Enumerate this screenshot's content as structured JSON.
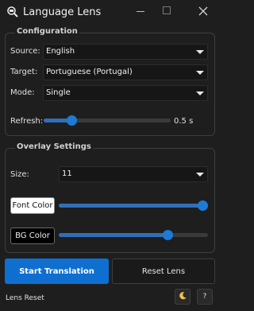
{
  "window": {
    "title": "Language Lens",
    "icon": "magnifier-icon"
  },
  "configuration": {
    "title": "Configuration",
    "source": {
      "label": "Source:",
      "value": "English"
    },
    "target": {
      "label": "Target:",
      "value": "Portuguese (Portugal)"
    },
    "mode": {
      "label": "Mode:",
      "value": "Single"
    },
    "refresh": {
      "label": "Refresh:",
      "value": "0.5 s",
      "level": 0.2
    }
  },
  "overlay": {
    "title": "Overlay Settings",
    "size": {
      "label": "Size:",
      "value": "11"
    },
    "font_color": {
      "label": "Font Color",
      "swatch": "#ffffff",
      "level": 1.0
    },
    "bg_color": {
      "label": "BG Color",
      "swatch": "#000000",
      "level": 0.75
    }
  },
  "actions": {
    "start_label": "Start Translation",
    "reset_label": "Reset Lens"
  },
  "footer": {
    "status": "Lens Reset",
    "theme_icon": "moon-icon",
    "help_label": "?"
  },
  "colors": {
    "accent": "#1e7ad4",
    "primary_button": "#0e6fd0",
    "background": "#1e1e1e"
  }
}
